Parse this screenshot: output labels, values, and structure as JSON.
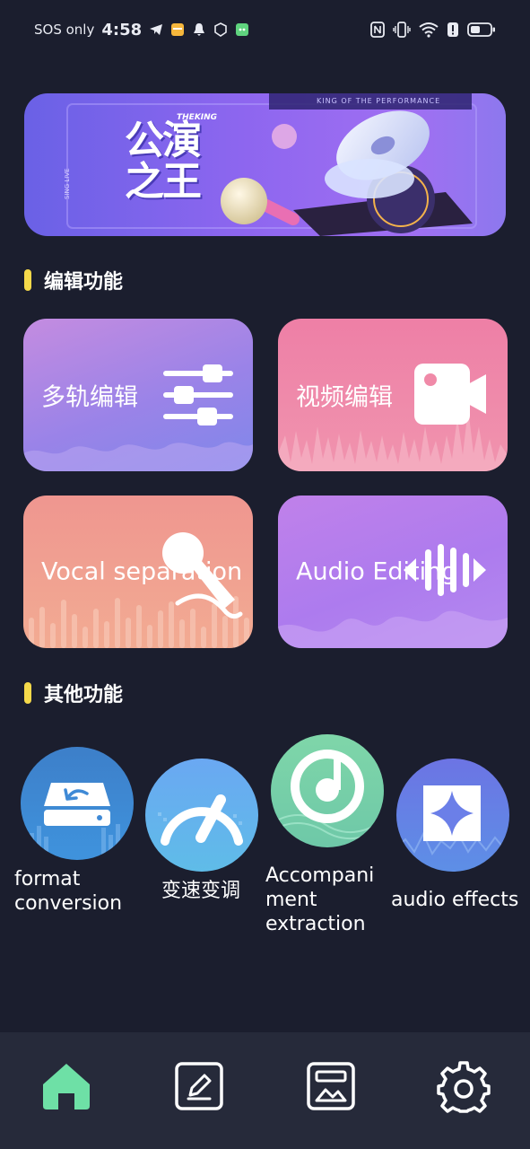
{
  "status_bar": {
    "carrier": "SOS only",
    "time": "4:58",
    "left_icons": [
      "telegram-icon",
      "notes-icon",
      "bell-icon",
      "box-icon",
      "chat-icon"
    ],
    "right_icons": [
      "nfc-icon",
      "vibrate-icon",
      "wifi-icon",
      "alert-icon",
      "battery-icon"
    ]
  },
  "banner": {
    "title_cn": "公演之王",
    "subtitle": "KING OF THE PERFORMANCE",
    "tag": "THEKING",
    "side_text": "SING LIVE"
  },
  "sections": {
    "edit": "编辑功能",
    "other": "其他功能"
  },
  "cards": [
    {
      "label": "多轨编辑",
      "icon": "sliders-icon"
    },
    {
      "label": "视频编辑",
      "icon": "video-camera-icon"
    },
    {
      "label": "Vocal separation",
      "icon": "microphone-icon"
    },
    {
      "label": "Audio Editing",
      "icon": "audio-bars-icon"
    }
  ],
  "tools": [
    {
      "label": "format\nconversion",
      "icon": "drive-undo-icon"
    },
    {
      "label": "变速变调",
      "icon": "speed-gauge-icon"
    },
    {
      "label": "Accompani\nment\nextraction",
      "icon": "music-disc-icon"
    },
    {
      "label": "audio effects",
      "icon": "sparkle-icon"
    }
  ],
  "nav": [
    {
      "name": "home",
      "icon": "home-icon",
      "active": true
    },
    {
      "name": "edit",
      "icon": "edit-icon",
      "active": false
    },
    {
      "name": "works",
      "icon": "gallery-icon",
      "active": false
    },
    {
      "name": "settings",
      "icon": "gear-icon",
      "active": false
    }
  ],
  "colors": {
    "background": "#1b1e2e",
    "accent_yellow": "#f5d94a",
    "nav_active": "#6ee0a6"
  }
}
